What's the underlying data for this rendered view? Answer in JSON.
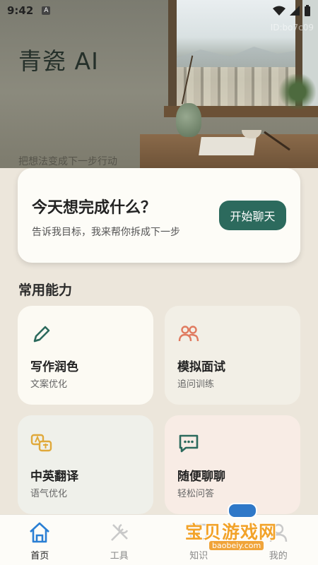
{
  "status_bar": {
    "time": "9:42"
  },
  "hero": {
    "title": "青瓷 AI",
    "subtitle": "把想法变成下一步行动",
    "id_text": "ID:bo7c09"
  },
  "task_card": {
    "question": "今天想完成什么？",
    "hint": "告诉我目标，我来帮你拆成下一步",
    "button_label": "开始聊天"
  },
  "section_title": "常用能力",
  "capabilities": [
    {
      "name": "写作润色",
      "desc": "文案优化",
      "icon": "pencil-icon",
      "accent": "#2c6a5d"
    },
    {
      "name": "模拟面试",
      "desc": "追问训练",
      "icon": "people-icon",
      "accent": "#e07a5f"
    },
    {
      "name": "中英翻译",
      "desc": "语气优化",
      "icon": "translate-icon",
      "accent": "#e0a93b"
    },
    {
      "name": "随便聊聊",
      "desc": "轻松问答",
      "icon": "chat-icon",
      "accent": "#2c6a5d"
    }
  ],
  "bottom_nav": [
    {
      "label": "首页",
      "icon": "home-icon",
      "active": true
    },
    {
      "label": "工具",
      "icon": "tools-icon",
      "active": false
    },
    {
      "label": "知识",
      "icon": "book-icon",
      "active": false
    },
    {
      "label": "我的",
      "icon": "user-icon",
      "active": false
    }
  ],
  "watermark": {
    "title": "宝贝游戏网",
    "url": "baobeiy.com"
  },
  "colors": {
    "accent": "#2c6a5d",
    "background": "#ece6db"
  }
}
